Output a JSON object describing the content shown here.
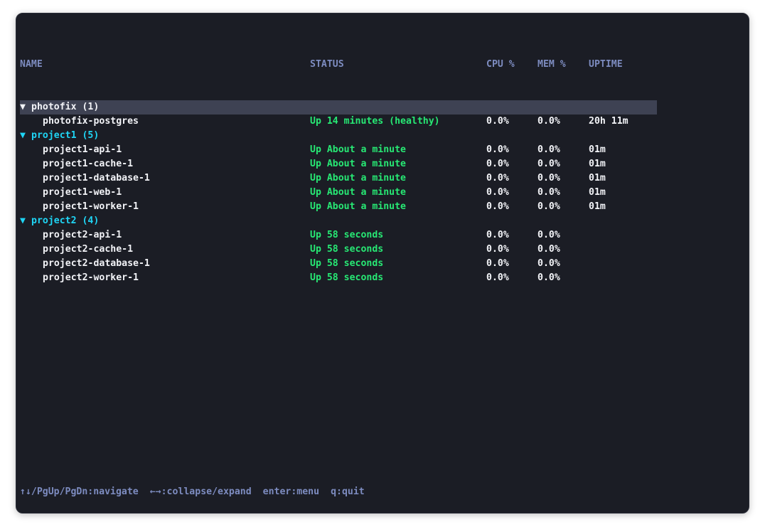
{
  "columns": {
    "name": "NAME",
    "status": "STATUS",
    "cpu": "CPU %",
    "mem": "MEM %",
    "uptime": "UPTIME"
  },
  "groups": [
    {
      "arrow": "▼",
      "label": "photofix (1)",
      "color": "#f2f3f7",
      "selected": true,
      "containers": [
        {
          "name": "photofix-postgres",
          "status": "Up 14 minutes (healthy)",
          "cpu": "0.0%",
          "mem": "0.0%",
          "uptime": "20h 11m"
        }
      ]
    },
    {
      "arrow": "▼",
      "label": "project1 (5)",
      "color": "#1fd5f5",
      "selected": false,
      "containers": [
        {
          "name": "project1-api-1",
          "status": "Up About a minute",
          "cpu": "0.0%",
          "mem": "0.0%",
          "uptime": "01m"
        },
        {
          "name": "project1-cache-1",
          "status": "Up About a minute",
          "cpu": "0.0%",
          "mem": "0.0%",
          "uptime": "01m"
        },
        {
          "name": "project1-database-1",
          "status": "Up About a minute",
          "cpu": "0.0%",
          "mem": "0.0%",
          "uptime": "01m"
        },
        {
          "name": "project1-web-1",
          "status": "Up About a minute",
          "cpu": "0.0%",
          "mem": "0.0%",
          "uptime": "01m"
        },
        {
          "name": "project1-worker-1",
          "status": "Up About a minute",
          "cpu": "0.0%",
          "mem": "0.0%",
          "uptime": "01m"
        }
      ]
    },
    {
      "arrow": "▼",
      "label": "project2 (4)",
      "color": "#1fd5f5",
      "selected": false,
      "containers": [
        {
          "name": "project2-api-1",
          "status": "Up 58 seconds",
          "cpu": "0.0%",
          "mem": "0.0%",
          "uptime": ""
        },
        {
          "name": "project2-cache-1",
          "status": "Up 58 seconds",
          "cpu": "0.0%",
          "mem": "0.0%",
          "uptime": ""
        },
        {
          "name": "project2-database-1",
          "status": "Up 58 seconds",
          "cpu": "0.0%",
          "mem": "0.0%",
          "uptime": ""
        },
        {
          "name": "project2-worker-1",
          "status": "Up 58 seconds",
          "cpu": "0.0%",
          "mem": "0.0%",
          "uptime": ""
        }
      ]
    }
  ],
  "footer": {
    "navigate": "↑↓/PgUp/PgDn:navigate",
    "collapse": "←→:collapse/expand",
    "menu": "enter:menu",
    "quit": "q:quit"
  },
  "colors": {
    "background": "#1b1d25",
    "header": "#7d8cc0",
    "status_up": "#27e874",
    "group_accent": "#1fd5f5",
    "selection": "#3e4253"
  }
}
